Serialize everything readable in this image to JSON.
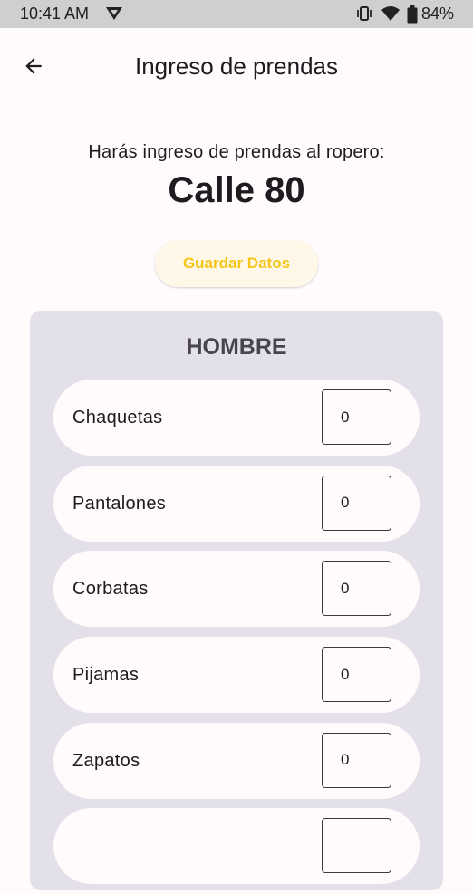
{
  "status_bar": {
    "time": "10:41 AM",
    "battery": "84%",
    "icons": [
      "notification-icon",
      "vibrate-icon",
      "wifi-icon",
      "battery-icon"
    ]
  },
  "app_bar": {
    "title": "Ingreso de prendas",
    "back_icon": "arrow-back-icon"
  },
  "header": {
    "subtitle": "Harás ingreso de prendas al ropero:",
    "location": "Calle 80"
  },
  "save_button": {
    "label": "Guardar Datos"
  },
  "section": {
    "title": "HOMBRE",
    "items": [
      {
        "label": "Chaquetas",
        "value": "0"
      },
      {
        "label": "Pantalones",
        "value": "0"
      },
      {
        "label": "Corbatas",
        "value": "0"
      },
      {
        "label": "Pijamas",
        "value": "0"
      },
      {
        "label": "Zapatos",
        "value": "0"
      },
      {
        "label": "",
        "value": ""
      }
    ]
  },
  "colors": {
    "background": "#fffbfd",
    "card": "#e4e0ea",
    "accent": "#f5c518",
    "button_bg": "#fff8e9",
    "status_bar": "#cfcfcf"
  }
}
